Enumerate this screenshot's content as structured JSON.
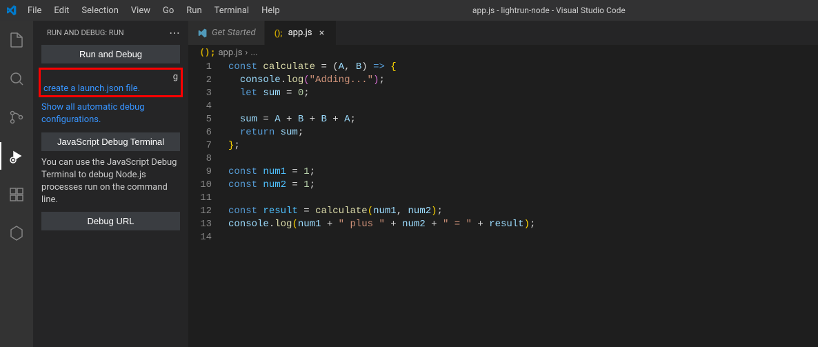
{
  "titlebar": {
    "title": "app.js - lightrun-node - Visual Studio Code"
  },
  "menubar": {
    "items": [
      "File",
      "Edit",
      "Selection",
      "View",
      "Go",
      "Run",
      "Terminal",
      "Help"
    ]
  },
  "sidebar": {
    "header": "RUN AND DEBUG: RUN",
    "run_debug_btn": "Run and Debug",
    "customize_text_partial": "g",
    "create_launch_link": "create a launch.json file.",
    "show_auto_link": "Show all automatic debug configurations.",
    "js_debug_terminal_btn": "JavaScript Debug Terminal",
    "js_debug_desc": "You can use the JavaScript Debug Terminal to debug Node.js processes run on the command line.",
    "debug_url_btn": "Debug URL"
  },
  "tabs": {
    "get_started": "Get Started",
    "app_js": "app.js"
  },
  "breadcrumb": {
    "file": "app.js",
    "sep": "›",
    "more": "..."
  },
  "code": {
    "line_numbers": [
      "1",
      "2",
      "3",
      "4",
      "5",
      "6",
      "7",
      "8",
      "9",
      "10",
      "11",
      "12",
      "13",
      "14"
    ],
    "lines": [
      {
        "t": "const ",
        "k": "kw",
        "t2": "calculate",
        "k2": "fn",
        "t3": " = (",
        "t4": "A",
        "k4": "param",
        "t5": ", ",
        "t6": "B",
        "k6": "param",
        "t7": ") ",
        "t8": "=>",
        "k8": "kw",
        "t9": " {",
        "k9": "brace"
      },
      {
        "indent": "  ",
        "t": "console",
        "k": "var",
        "t2": ".",
        "t3": "log",
        "k3": "fn",
        "t4": "(",
        "k4": "brace2",
        "t5": "\"Adding...\"",
        "k5": "str",
        "t6": ")",
        "k6": "brace2",
        "t7": ";"
      },
      {
        "indent": "  ",
        "t": "let ",
        "k": "kw",
        "t2": "sum",
        "k2": "var",
        "t3": " = ",
        "t4": "0",
        "k4": "num",
        "t5": ";"
      },
      {
        "blank": true
      },
      {
        "indent": "  ",
        "t": "sum",
        "k": "var",
        "t2": " = ",
        "t3": "A",
        "k3": "param",
        "t4": " + ",
        "t5": "B",
        "k5": "param",
        "t6": " + ",
        "t7": "B",
        "k7": "param",
        "t8": " + ",
        "t9": "A",
        "k9": "param",
        "t10": ";"
      },
      {
        "indent": "  ",
        "t": "return ",
        "k": "kw",
        "t2": "sum",
        "k2": "var",
        "t3": ";"
      },
      {
        "t": "}",
        "k": "brace",
        "t2": ";"
      },
      {
        "blank": true
      },
      {
        "t": "const ",
        "k": "kw",
        "t2": "num1",
        "k2": "const",
        "t3": " = ",
        "t4": "1",
        "k4": "num",
        "t5": ";"
      },
      {
        "t": "const ",
        "k": "kw",
        "t2": "num2",
        "k2": "const",
        "t3": " = ",
        "t4": "1",
        "k4": "num",
        "t5": ";"
      },
      {
        "blank": true
      },
      {
        "t": "const ",
        "k": "kw",
        "t2": "result",
        "k2": "const",
        "t3": " = ",
        "t4": "calculate",
        "k4": "fn",
        "t5": "(",
        "k5": "brace",
        "t6": "num1",
        "k6": "var",
        "t7": ", ",
        "t8": "num2",
        "k8": "var",
        "t9": ")",
        "k9": "brace",
        "t10": ";"
      },
      {
        "t": "console",
        "k": "var",
        "t2": ".",
        "t3": "log",
        "k3": "fn",
        "t4": "(",
        "k4": "brace",
        "t5": "num1",
        "k5": "var",
        "t6": " + ",
        "t7": "\" plus \"",
        "k7": "str",
        "t8": " + ",
        "t9": "num2",
        "k9": "var",
        "t10": " + ",
        "t11": "\" = \"",
        "k11": "str",
        "t12": " + ",
        "t13": "result",
        "k13": "var",
        "t14": ")",
        "k14": "brace",
        "t15": ";"
      },
      {
        "blank": true
      }
    ]
  }
}
